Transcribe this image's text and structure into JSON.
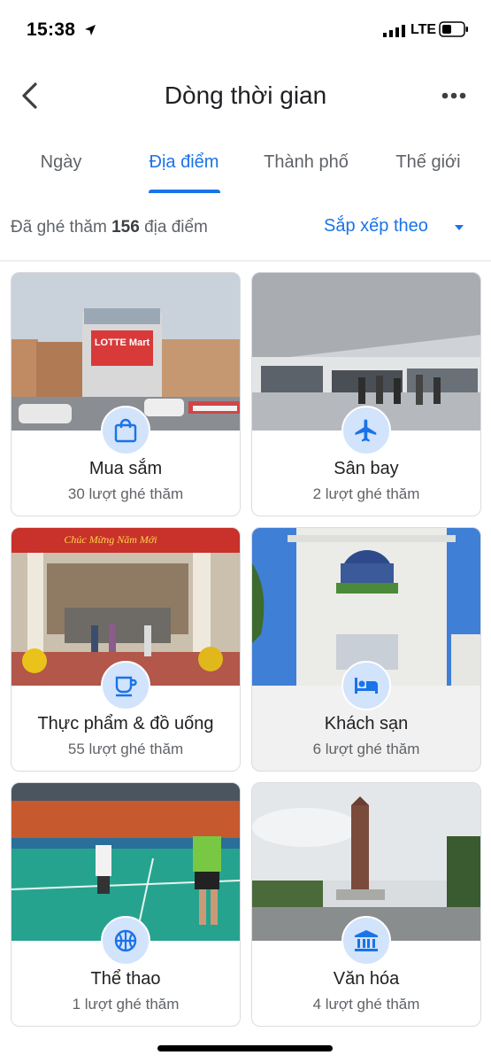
{
  "status_bar": {
    "time": "15:38",
    "network": "LTE"
  },
  "app_bar": {
    "title": "Dòng thời gian",
    "back_icon": "back-arrow-icon",
    "more_icon": "more-vert-icon"
  },
  "tabs": [
    {
      "label": "Ngày",
      "active": false
    },
    {
      "label": "Địa điểm",
      "active": true
    },
    {
      "label": "Thành phố",
      "active": false
    },
    {
      "label": "Thế giới",
      "active": false
    }
  ],
  "summary": {
    "prefix": "Đã ghé thăm",
    "count": "156",
    "suffix": "địa điểm"
  },
  "sort": {
    "label": "Sắp xếp theo"
  },
  "colors": {
    "accent": "#1a73e8",
    "badge_bg": "#d2e3fc",
    "text": "#202124",
    "muted": "#5f6368"
  },
  "categories": [
    {
      "name": "Mua sắm",
      "visits": "30 lượt ghé thăm",
      "icon": "shopping-bag-icon",
      "photo_sign": "LOTTE Mart"
    },
    {
      "name": "Sân bay",
      "visits": "2 lượt ghé thăm",
      "icon": "airplane-icon"
    },
    {
      "name": "Thực phẩm & đồ uống",
      "visits": "55 lượt ghé thăm",
      "icon": "coffee-cup-icon",
      "photo_banner": "Chúc Mừng Năm Mới"
    },
    {
      "name": "Khách sạn",
      "visits": "6 lượt ghé thăm",
      "icon": "bed-icon"
    },
    {
      "name": "Thể thao",
      "visits": "1 lượt ghé thăm",
      "icon": "sports-ball-icon"
    },
    {
      "name": "Văn hóa",
      "visits": "4 lượt ghé thăm",
      "icon": "museum-icon"
    }
  ]
}
